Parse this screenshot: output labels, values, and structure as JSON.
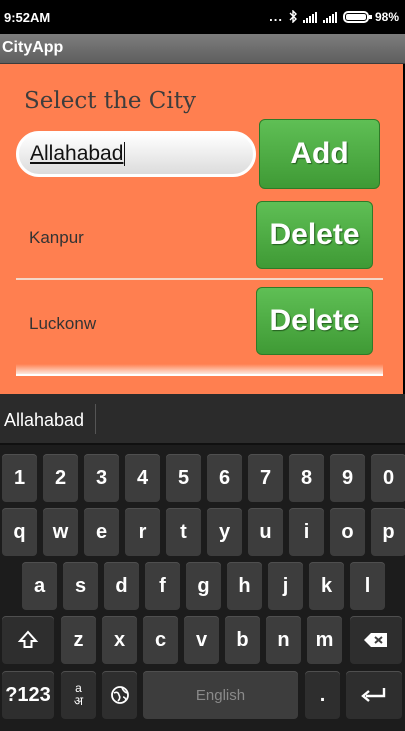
{
  "status_bar": {
    "time": "9:52AM",
    "dots": "...",
    "battery_percent": "98%",
    "icons": [
      "bluetooth-icon",
      "signal-icon",
      "signal-icon",
      "battery-icon"
    ]
  },
  "app_bar": {
    "title": "CityApp"
  },
  "main": {
    "heading": "Select the City",
    "input": {
      "value": "Allahabad"
    },
    "add_label": "Add",
    "cities": [
      {
        "name": "Kanpur",
        "delete_label": "Delete"
      },
      {
        "name": "Luckonw",
        "delete_label": "Delete"
      }
    ]
  },
  "keyboard": {
    "suggestion": "Allahabad",
    "row_numbers": [
      "1",
      "2",
      "3",
      "4",
      "5",
      "6",
      "7",
      "8",
      "9",
      "0"
    ],
    "row1": [
      "q",
      "w",
      "e",
      "r",
      "t",
      "y",
      "u",
      "i",
      "o",
      "p"
    ],
    "row2": [
      "a",
      "s",
      "d",
      "f",
      "g",
      "h",
      "j",
      "k",
      "l"
    ],
    "row3": [
      "z",
      "x",
      "c",
      "v",
      "b",
      "n",
      "m"
    ],
    "symbols_label": "?123",
    "lang_key": {
      "top": "a",
      "bottom": "अ"
    },
    "space_label": "English",
    "period_label": ".",
    "icons": [
      "shift-icon",
      "backspace-icon",
      "globe-icon",
      "enter-icon"
    ]
  },
  "colors": {
    "panel": "#ff7f50",
    "button_green": "#4cae42",
    "app_bar": "#6e6e6e",
    "keyboard_bg": "#1c1c1c"
  }
}
